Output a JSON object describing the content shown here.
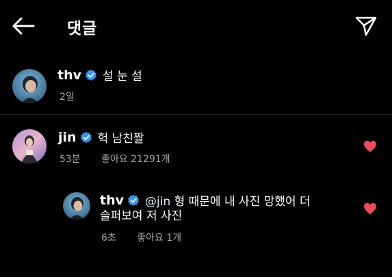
{
  "header": {
    "title": "댓글"
  },
  "icons": {
    "back": "arrow-left-icon",
    "share": "send-icon",
    "verified": "verified-badge-icon",
    "like": "heart-icon"
  },
  "colors": {
    "background": "#000000",
    "verified": "#3897f0",
    "like": "#ed4956",
    "secondary_text": "#a8a8a8"
  },
  "caption": {
    "username": "thv",
    "text": "설 눈 설",
    "time": "2일"
  },
  "comments": [
    {
      "username": "jin",
      "text": "헉 남친짤",
      "time": "53분",
      "likes": "좋아요 21291개",
      "liked": true
    }
  ],
  "reply": {
    "username": "thv",
    "mention": "@jin",
    "text_line1": "형 때문에 내 사진 망했어 더",
    "text_line2": "슬퍼보여 저 사진",
    "time": "6초",
    "likes": "좋아요 1개",
    "liked": true
  }
}
